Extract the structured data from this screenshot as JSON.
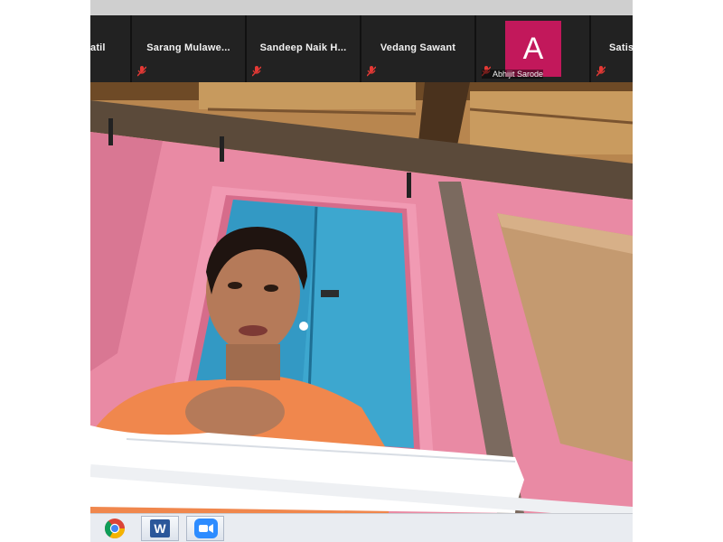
{
  "participants": [
    {
      "name": "atil"
    },
    {
      "name": "Sarang  Mulawe..."
    },
    {
      "name": "Sandeep  Naik  H..."
    },
    {
      "name": "Vedang Sawant"
    },
    {
      "name": "Abhijit Sarode",
      "avatar_letter": "A"
    },
    {
      "name": "Satis"
    }
  ],
  "colors": {
    "avatar_bg": "#c2185b",
    "muted_icon": "#e53935",
    "strip_bg": "#1c1c1c",
    "taskbar_bg": "#e9ecf1"
  },
  "taskbar": {
    "apps": [
      {
        "icon": "chrome-icon"
      },
      {
        "icon": "word-icon",
        "letter": "W"
      },
      {
        "icon": "zoom-icon"
      }
    ]
  }
}
